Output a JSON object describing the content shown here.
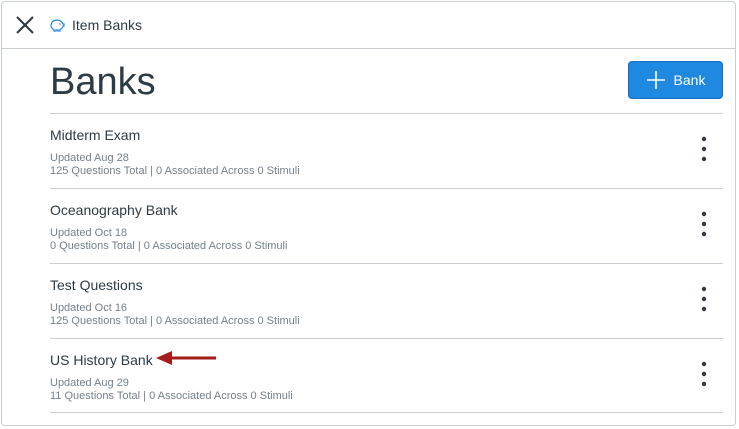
{
  "header": {
    "breadcrumb_label": "Item Banks"
  },
  "page": {
    "title": "Banks",
    "add_button_label": "Bank"
  },
  "banks": [
    {
      "title": "Midterm Exam",
      "updated": "Updated Aug 28",
      "stats": "125 Questions Total | 0 Associated Across 0 Stimuli"
    },
    {
      "title": "Oceanography Bank",
      "updated": "Updated Oct 18",
      "stats": "0 Questions Total | 0 Associated Across 0 Stimuli"
    },
    {
      "title": "Test Questions",
      "updated": "Updated Oct 16",
      "stats": "125 Questions Total | 0 Associated Across 0 Stimuli"
    },
    {
      "title": "US History Bank",
      "updated": "Updated Aug 29",
      "stats": "11 Questions Total | 0 Associated Across 0 Stimuli"
    }
  ],
  "colors": {
    "accent": "#1f88e0",
    "annotation_arrow": "#a31d1d",
    "text_primary": "#2d3b45",
    "text_secondary": "#73818c"
  }
}
